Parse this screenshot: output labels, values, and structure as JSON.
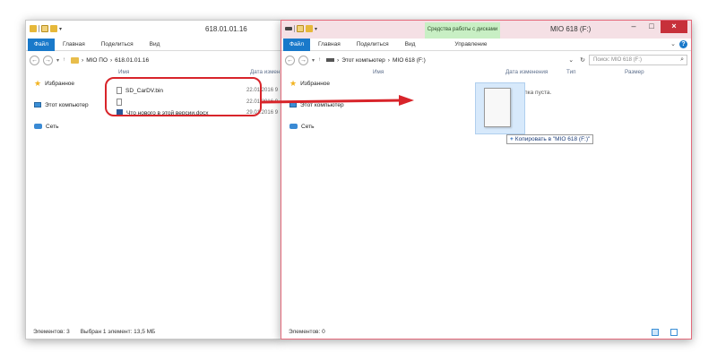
{
  "left": {
    "title": "618.01.01.16",
    "tabs": {
      "file": "Файл",
      "home": "Главная",
      "share": "Поделиться",
      "view": "Вид"
    },
    "breadcrumb": [
      "МІО ПО",
      "618.01.01.16"
    ],
    "nav": {
      "favorites": "Избранное",
      "computer": "Этот компьютер",
      "network": "Сеть"
    },
    "columns": {
      "name": "Имя",
      "date": "Дата измен"
    },
    "files": [
      {
        "name": "SD_CarDV.bin",
        "date": "22.01.2016 9"
      },
      {
        "name": "",
        "date": "22.01.2016 9"
      },
      {
        "name": "Что нового в этой версии.docx",
        "date": "29.01.2016 9"
      }
    ],
    "status": {
      "count": "Элементов: 3",
      "selected": "Выбран 1 элемент: 13,5 МБ"
    }
  },
  "right": {
    "title": "MIO 618 (F:)",
    "context_tab": "Средства работы с дисками",
    "tabs": {
      "file": "Файл",
      "home": "Главная",
      "share": "Поделиться",
      "view": "Вид",
      "manage": "Управление"
    },
    "breadcrumb": [
      "Этот компьютер",
      "MIO 618 (F:)"
    ],
    "search_placeholder": "Поиск: MIO 618 (F:)",
    "nav": {
      "favorites": "Избранное",
      "computer": "Этот компьютер",
      "network": "Сеть"
    },
    "columns": {
      "name": "Имя",
      "date": "Дата изменения",
      "type": "Тип",
      "size": "Размер"
    },
    "empty_msg": "Эта папка пуста.",
    "copy_tooltip": "Копировать в \"MIO 618 (F:)\"",
    "status": {
      "count": "Элементов: 0"
    }
  },
  "colors": {
    "accent": "#1979ca",
    "highlight": "#d8242a",
    "context_tab": "#c8efc4"
  }
}
